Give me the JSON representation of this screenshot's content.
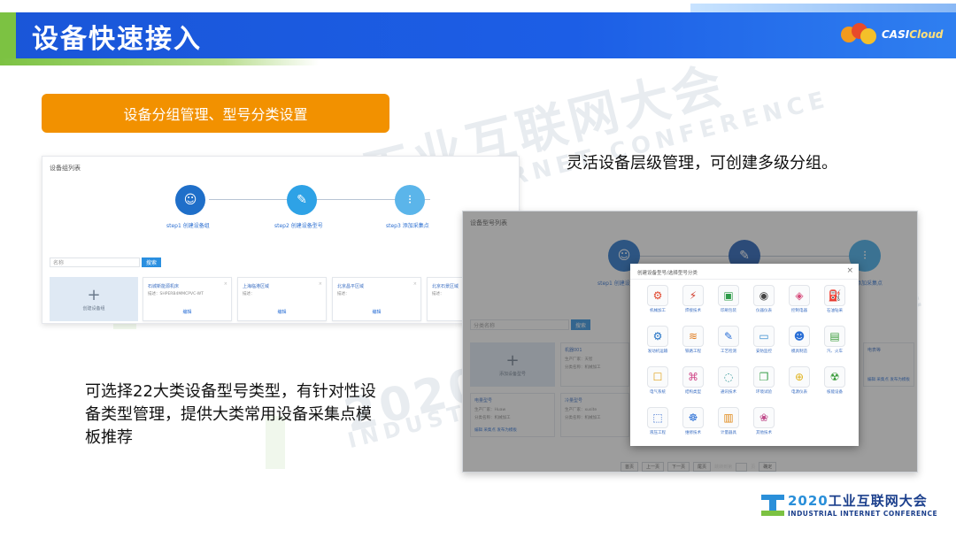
{
  "header": {
    "title": "设备快速接入",
    "logo": {
      "prefix": "CASI",
      "suffix": "Cloud"
    }
  },
  "section_tag": "设备分组管理、型号分类设置",
  "caption_right": "灵活设备层级管理，可创建多级分组。",
  "caption_left": "可选择22大类设备型号类型，有针对性设备类型管理，提供大类常用设备采集点模板推荐",
  "watermark": {
    "cn": "2020 工业互联网大会",
    "en": "INDUSTRIAL INTERNET CONFERENCE"
  },
  "screenshot1": {
    "list_title": "设备组列表",
    "steps": [
      {
        "label": "step1 创建设备组",
        "icon": "user-group-icon"
      },
      {
        "label": "step2 创建设备型号",
        "icon": "edit-icon"
      },
      {
        "label": "step3 添加采集点",
        "icon": "sensor-icon"
      }
    ],
    "search_placeholder": "名称",
    "search_button": "搜索",
    "add_label": "创建设备组",
    "cards": [
      {
        "name": "石城新能源机床",
        "desc": "描述：SHPERB4MMCPVC-WT",
        "edit": "编辑"
      },
      {
        "name": "上海临港区域",
        "desc": "描述：",
        "edit": "编辑"
      },
      {
        "name": "北京昌平区域",
        "desc": "描述：",
        "edit": "编辑"
      },
      {
        "name": "北京石景区域",
        "desc": "描述：",
        "edit": "编辑"
      }
    ]
  },
  "screenshot2": {
    "list_title": "设备型号列表",
    "steps": [
      {
        "label": "step1 创建设",
        "icon": "user-group-icon"
      },
      {
        "label": "",
        "icon": "edit-icon"
      },
      {
        "label": "添加采集点",
        "icon": "sensor-icon"
      }
    ],
    "search_placeholder": "分类名称",
    "search_button": "搜索",
    "add_label": "添加设备型号",
    "bg_cards": [
      {
        "name": "机器001",
        "lines": [
          "生产厂家：天智",
          "分类名称：机械加工"
        ],
        "actions": ""
      },
      {
        "name": "电量型号",
        "lines": [
          "生产厂家：Huaw",
          "分类名称：机械加工"
        ],
        "actions": "编辑 采集点 发布为模板"
      },
      {
        "name": "冷量型号",
        "lines": [
          "生产厂家：xusite",
          "分类名称：机械加工"
        ],
        "actions": ""
      },
      {
        "name": "电表等",
        "lines": [],
        "actions": "编辑 采集点 发布为模板"
      }
    ],
    "pager": [
      "首页",
      "上一页",
      "下一页",
      "尾页",
      "跳转到第",
      "页",
      "确定"
    ],
    "dialog": {
      "title": "创建设备型号/选择型号分类",
      "close": "×",
      "types": [
        {
          "label": "机械加工",
          "icon": "robot-arm-icon",
          "glyph": "⚙",
          "color": "#e0442a"
        },
        {
          "label": "焊接技术",
          "icon": "welding-icon",
          "glyph": "⚡",
          "color": "#d03a2a"
        },
        {
          "label": "印刷包装",
          "icon": "printer-icon",
          "glyph": "▣",
          "color": "#2f9c4a"
        },
        {
          "label": "仪器仪表",
          "icon": "gauge-icon",
          "glyph": "◉",
          "color": "#444444"
        },
        {
          "label": "控制电器",
          "icon": "control-icon",
          "glyph": "◈",
          "color": "#d64a7a"
        },
        {
          "label": "石油钻采",
          "icon": "oil-icon",
          "glyph": "⛽",
          "color": "#d23a2a"
        },
        {
          "label": "发动机运输",
          "icon": "engine-icon",
          "glyph": "⚙",
          "color": "#1d6fc4"
        },
        {
          "label": "铁路工程",
          "icon": "railway-icon",
          "glyph": "≋",
          "color": "#e07a1a"
        },
        {
          "label": "工艺检测",
          "icon": "wrench-icon",
          "glyph": "✎",
          "color": "#2a6fd6"
        },
        {
          "label": "安防监控",
          "icon": "monitor-icon",
          "glyph": "▭",
          "color": "#3a8fd0"
        },
        {
          "label": "模具制造",
          "icon": "worker-icon",
          "glyph": "☻",
          "color": "#2a6fd6"
        },
        {
          "label": "汽、火车",
          "icon": "train-icon",
          "glyph": "▤",
          "color": "#3a9c3a"
        },
        {
          "label": "电气系统",
          "icon": "electric-icon",
          "glyph": "☐",
          "color": "#e0a21a"
        },
        {
          "label": "结构类型",
          "icon": "structure-icon",
          "glyph": "⌘",
          "color": "#d04a8a"
        },
        {
          "label": "通讯技术",
          "icon": "signal-icon",
          "glyph": "◌",
          "color": "#3a9c9c"
        },
        {
          "label": "环境试验",
          "icon": "environment-icon",
          "glyph": "❐",
          "color": "#3aa04a"
        },
        {
          "label": "电源仪表",
          "icon": "power-icon",
          "glyph": "⊕",
          "color": "#e0b21a"
        },
        {
          "label": "核能设备",
          "icon": "nuclear-icon",
          "glyph": "☢",
          "color": "#3a9c3a"
        },
        {
          "label": "液压工程",
          "icon": "hydraulic-icon",
          "glyph": "⬚",
          "color": "#3a6ed0"
        },
        {
          "label": "维修技术",
          "icon": "repair-icon",
          "glyph": "☸",
          "color": "#2a6fd6"
        },
        {
          "label": "计量器具",
          "icon": "meter-icon",
          "glyph": "▥",
          "color": "#e08a1a"
        },
        {
          "label": "其他技术",
          "icon": "other-icon",
          "glyph": "❀",
          "color": "#c04a8a"
        }
      ]
    }
  },
  "footer": {
    "year": "2020",
    "cn": "工业互联网大会",
    "en": "INDUSTRIAL INTERNET CONFERENCE"
  }
}
